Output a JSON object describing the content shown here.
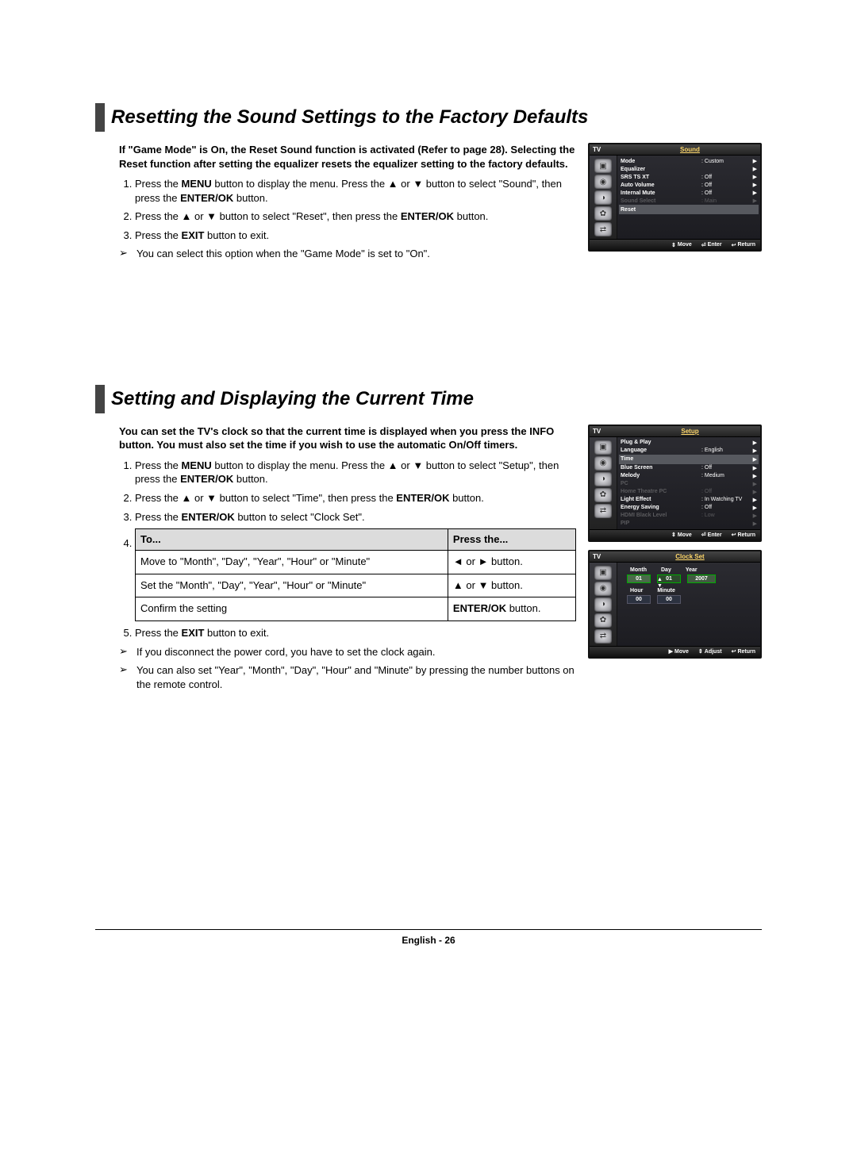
{
  "section1": {
    "title": "Resetting the Sound Settings to the Factory Defaults",
    "intro": "If \"Game Mode\" is On, the Reset Sound function is activated (Refer to page 28). Selecting the Reset function after setting the equalizer resets the equalizer setting to the factory defaults.",
    "step1a": "Press the ",
    "step1b": "MENU",
    "step1c": " button to display the menu. Press the ▲ or ▼ button to select \"Sound\", then press the ",
    "step1d": "ENTER/OK",
    "step1e": " button.",
    "step2a": "Press the ▲ or ▼ button to select \"Reset\", then press the ",
    "step2b": "ENTER/OK",
    "step2c": " button.",
    "step3a": "Press the ",
    "step3b": "EXIT",
    "step3c": " button to exit.",
    "note": "You can select this option when the \"Game Mode\" is set to \"On\"."
  },
  "osd1": {
    "tv": "TV",
    "title": "Sound",
    "rows": {
      "r0l": "Mode",
      "r0v": ": Custom",
      "r1l": "Equalizer",
      "r1v": "",
      "r2l": "SRS TS XT",
      "r2v": ": Off",
      "r3l": "Auto Volume",
      "r3v": ": Off",
      "r4l": "Internal Mute",
      "r4v": ": Off",
      "r5l": "Sound Select",
      "r5v": ": Main",
      "r6l": "Reset",
      "r6v": ""
    },
    "foot": {
      "move": "Move",
      "enter": "Enter",
      "return": "Return"
    }
  },
  "section2": {
    "title": "Setting and Displaying the Current Time",
    "intro": "You can set the TV's clock so that the current time is displayed when you press the INFO button. You must also set the time if you wish to use the automatic On/Off timers.",
    "step1a": "Press the ",
    "step1b": "MENU",
    "step1c": " button to display the menu. Press the ▲ or ▼ button to select \"Setup\", then press the ",
    "step1d": "ENTER/OK",
    "step1e": " button.",
    "step2a": "Press the ▲ or ▼ button to select \"Time\", then press the ",
    "step2b": "ENTER/OK",
    "step2c": " button.",
    "step3a": "Press the ",
    "step3b": "ENTER/OK",
    "step3c": " button to select \"Clock Set\".",
    "table": {
      "h1": "To...",
      "h2": "Press the...",
      "r1c1": "Move to \"Month\", \"Day\", \"Year\", \"Hour\" or \"Minute\"",
      "r1c2": "◄ or ► button.",
      "r2c1": "Set the \"Month\", \"Day\", \"Year\", \"Hour\" or \"Minute\"",
      "r2c2": "▲ or ▼ button.",
      "r3c1": "Confirm the setting",
      "r3c2a": "ENTER/OK",
      "r3c2b": " button."
    },
    "step5a": "Press the ",
    "step5b": "EXIT",
    "step5c": " button to exit.",
    "note1": "If you disconnect the power cord, you have to set the clock again.",
    "note2": "You can also set \"Year\", \"Month\", \"Day\", \"Hour\" and \"Minute\" by pressing the number buttons on the remote control."
  },
  "osd2": {
    "tv": "TV",
    "title": "Setup",
    "rows": {
      "r0l": "Plug & Play",
      "r0v": "",
      "r1l": "Language",
      "r1v": ": English",
      "r2l": "Time",
      "r2v": "",
      "r3l": "Blue Screen",
      "r3v": ": Off",
      "r4l": "Melody",
      "r4v": ": Medium",
      "r5l": "PC",
      "r5v": "",
      "r6l": "Home Theatre PC",
      "r6v": ": Off",
      "r7l": "Light Effect",
      "r7v": ": In Watching TV",
      "r8l": "Energy Saving",
      "r8v": ": Off",
      "r9l": "HDMI Black Level",
      "r9v": ": Low",
      "r10l": "PIP",
      "r10v": ""
    },
    "foot": {
      "move": "Move",
      "enter": "Enter",
      "return": "Return"
    }
  },
  "osd3": {
    "tv": "TV",
    "title": "Clock Set",
    "labels": {
      "month": "Month",
      "day": "Day",
      "year": "Year",
      "hour": "Hour",
      "minute": "Minute"
    },
    "vals": {
      "month": "01",
      "day": "01",
      "year": "2007",
      "hour": "00",
      "minute": "00"
    },
    "foot": {
      "move": "Move",
      "adjust": "Adjust",
      "return": "Return"
    }
  },
  "footer": "English - 26",
  "glyph": {
    "note": "➢",
    "tri_r": "▶",
    "tri_l": "◀",
    "tri_u": "▲",
    "tri_d": "▼",
    "ud": "⇕",
    "lr": "↔",
    "enter": "⏎",
    "ret": "↩"
  }
}
